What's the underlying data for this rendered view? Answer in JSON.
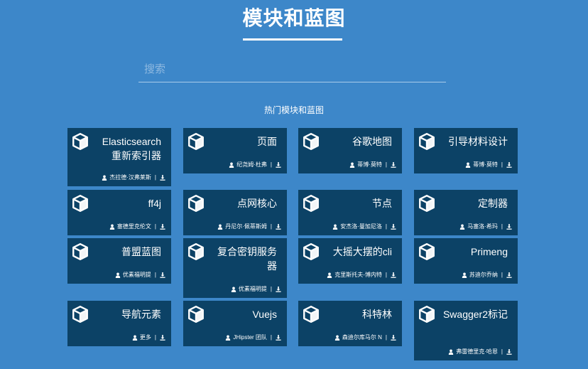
{
  "header": {
    "title": "模块和蓝图"
  },
  "search": {
    "placeholder": "搜索",
    "value": ""
  },
  "section": {
    "heading": "热门模块和蓝图"
  },
  "cards": [
    {
      "title": "Elasticsearch 重新索引器",
      "author": "杰拉德·汉弗莱斯",
      "icon": "cube-icon"
    },
    {
      "title": "页面",
      "author": "纪尧姆·杜弗",
      "icon": "cube-icon"
    },
    {
      "title": "谷歌地图",
      "author": "蒂博·莫特",
      "icon": "cube-icon"
    },
    {
      "title": "引导材料设计",
      "author": "蒂博·莫特",
      "icon": "cube-icon"
    },
    {
      "title": "ff4j",
      "author": "塞德里克伦文",
      "icon": "cube-icon"
    },
    {
      "title": "点网核心",
      "author": "丹尼尔·佩蒂斯姆",
      "icon": "cube-icon"
    },
    {
      "title": "节点",
      "author": "安杰洛·曼加尼洛",
      "icon": "cube-icon"
    },
    {
      "title": "定制器",
      "author": "马塞洛·希玛",
      "icon": "cube-icon"
    },
    {
      "title": "普盟蓝图",
      "author": "优素福明提",
      "icon": "cube-icon"
    },
    {
      "title": "复合密钥服务器",
      "author": "优素福明提",
      "icon": "cube-icon"
    },
    {
      "title": "大摇大摆的cli",
      "author": "克里斯托夫-博内特",
      "icon": "cube-icon"
    },
    {
      "title": "Primeng",
      "author": "苏迪尔乔纳",
      "icon": "cube-icon"
    },
    {
      "title": "导航元素",
      "author": "更多",
      "icon": "cube-icon"
    },
    {
      "title": "Vuejs",
      "author": "JHipster 团队",
      "icon": "cube-icon"
    },
    {
      "title": "科特林",
      "author": "森迪尔库马尔 N",
      "icon": "cube-icon"
    },
    {
      "title": "Swagger2标记",
      "author": "弗雷德里克·哈恩",
      "icon": "cube-icon"
    }
  ],
  "colors": {
    "background": "#3d87c9",
    "card": "#0c4266",
    "text": "#ffffff"
  }
}
